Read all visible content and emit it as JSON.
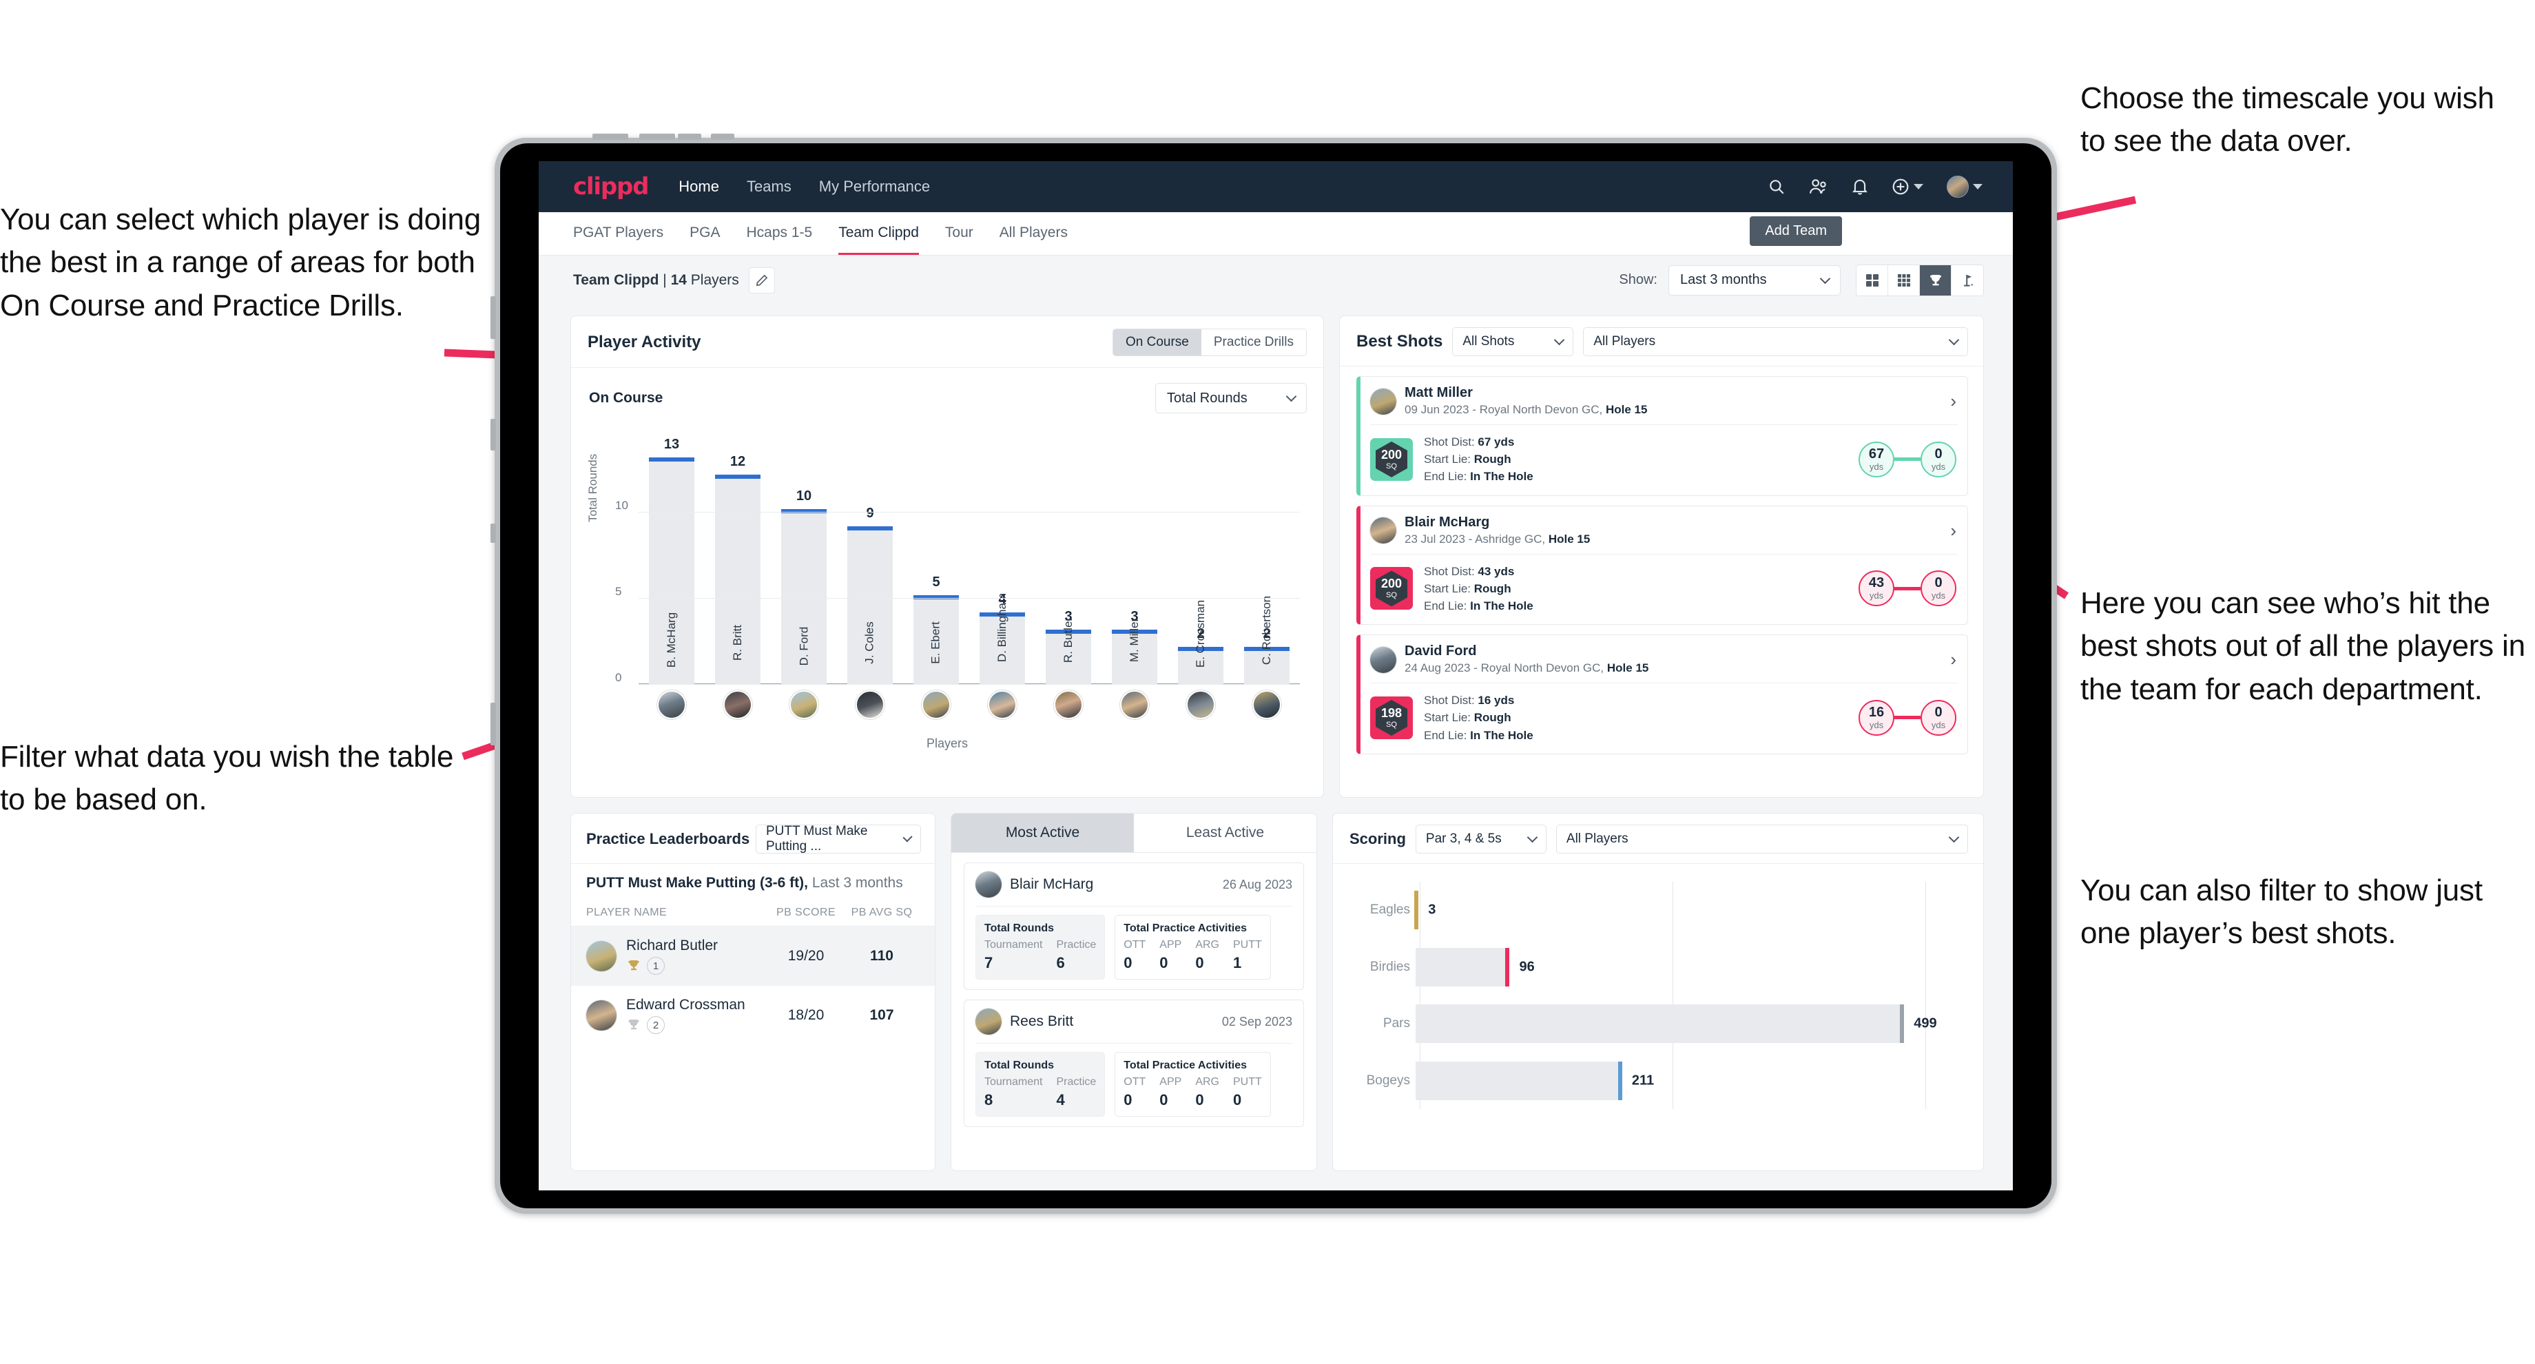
{
  "annotations": {
    "left_top": "You can select which player is doing the best in a range of areas for both On Course and Practice Drills.",
    "left_bottom": "Filter what data you wish the table to be based on.",
    "right_top": "Choose the timescale you wish to see the data over.",
    "right_middle": "Here you can see who’s hit the best shots out of all the players in the team for each department.",
    "right_bottom": "You can also filter to show just one player’s best shots."
  },
  "app": {
    "brand": "clippd",
    "nav": [
      {
        "label": "Home",
        "active": true
      },
      {
        "label": "Teams",
        "active": false
      },
      {
        "label": "My Performance",
        "active": false
      }
    ],
    "nav_icons": [
      "search-icon",
      "people-icon",
      "bell-icon",
      "plus-circle-icon",
      "avatar-icon"
    ],
    "tabs": [
      {
        "label": "PGAT Players",
        "active": false
      },
      {
        "label": "PGA",
        "active": false
      },
      {
        "label": "Hcaps 1-5",
        "active": false
      },
      {
        "label": "Team Clippd",
        "active": true
      },
      {
        "label": "Tour",
        "active": false
      },
      {
        "label": "All Players",
        "active": false
      }
    ],
    "add_team_tooltip": "Add Team",
    "subheader": {
      "team_name": "Team Clippd",
      "separator": " | ",
      "player_count": "14",
      "players_word": " Players",
      "show_label": "Show:",
      "timescale_value": "Last 3 months",
      "view_buttons": [
        "grid-2x2-icon",
        "grid-3x3-icon",
        "trophy-icon",
        "flag-icon"
      ],
      "active_view": "trophy-icon"
    }
  },
  "player_activity": {
    "title": "Player Activity",
    "segments": [
      {
        "label": "On Course",
        "active": true
      },
      {
        "label": "Practice Drills",
        "active": false
      }
    ],
    "sub_title": "On Course",
    "metric_select": "Total Rounds"
  },
  "chart_data": [
    {
      "type": "bar",
      "title": "Player Activity — On Course",
      "xlabel": "Players",
      "ylabel": "Total Rounds",
      "ylim": [
        0,
        14
      ],
      "yticks": [
        0,
        5,
        10
      ],
      "grid": true,
      "categories": [
        "B. McHarg",
        "R. Britt",
        "D. Ford",
        "J. Coles",
        "E. Ebert",
        "D. Billingham",
        "R. Butler",
        "M. Miller",
        "E. Crossman",
        "C. Robertson"
      ],
      "values": [
        13,
        12,
        10,
        9,
        5,
        4,
        3,
        3,
        2,
        2
      ],
      "bar_color": "#e8eaed",
      "cap_color": "#2f6fd0"
    },
    {
      "type": "bar",
      "orientation": "horizontal",
      "title": "Scoring",
      "categories": [
        "Eagles",
        "Birdies",
        "Pars",
        "Bogeys"
      ],
      "values": [
        3,
        96,
        499,
        211
      ],
      "xlim": [
        0,
        560
      ],
      "grid": true,
      "cap_colors": [
        "#c8a552",
        "#ec2c5d",
        "#9aa3ab",
        "#5b9bd5"
      ],
      "bar_color": "#e8eaed"
    }
  ],
  "best_shots": {
    "title": "Best Shots",
    "filter_shots": "All Shots",
    "filter_players": "All Players",
    "shots": [
      {
        "player": "Matt Miller",
        "meta_prefix": "09 Jun 2023 - Royal North Devon GC, ",
        "hole": "Hole 15",
        "sq": "200",
        "sq_unit": "SQ",
        "accent": "#63d3b0",
        "shot_dist_label": "Shot Dist: ",
        "shot_dist": "67 yds",
        "start_lie_label": "Start Lie: ",
        "start_lie": "Rough",
        "end_lie_label": "End Lie: ",
        "end_lie": "In The Hole",
        "from_value": "67",
        "from_unit": "yds",
        "to_value": "0",
        "to_unit": "yds"
      },
      {
        "player": "Blair McHarg",
        "meta_prefix": "23 Jul 2023 - Ashridge GC, ",
        "hole": "Hole 15",
        "sq": "200",
        "sq_unit": "SQ",
        "accent": "#ec2c5d",
        "shot_dist_label": "Shot Dist: ",
        "shot_dist": "43 yds",
        "start_lie_label": "Start Lie: ",
        "start_lie": "Rough",
        "end_lie_label": "End Lie: ",
        "end_lie": "In The Hole",
        "from_value": "43",
        "from_unit": "yds",
        "to_value": "0",
        "to_unit": "yds"
      },
      {
        "player": "David Ford",
        "meta_prefix": "24 Aug 2023 - Royal North Devon GC, ",
        "hole": "Hole 15",
        "sq": "198",
        "sq_unit": "SQ",
        "accent": "#ec2c5d",
        "shot_dist_label": "Shot Dist: ",
        "shot_dist": "16 yds",
        "start_lie_label": "Start Lie: ",
        "start_lie": "Rough",
        "end_lie_label": "End Lie: ",
        "end_lie": "In The Hole",
        "from_value": "16",
        "from_unit": "yds",
        "to_value": "0",
        "to_unit": "yds"
      }
    ]
  },
  "practice_leaderboards": {
    "title": "Practice Leaderboards",
    "drill_select": "PUTT Must Make Putting ...",
    "subtitle_bold": "PUTT Must Make Putting (3-6 ft),",
    "subtitle_rest": " Last 3 months",
    "columns": [
      "PLAYER NAME",
      "PB SCORE",
      "PB AVG SQ"
    ],
    "rows": [
      {
        "name": "Richard Butler",
        "rank": "1",
        "trophy": "gold",
        "pb_score": "19/20",
        "pb_avg_sq": "110"
      },
      {
        "name": "Edward Crossman",
        "rank": "2",
        "trophy": "silver",
        "pb_score": "18/20",
        "pb_avg_sq": "107"
      }
    ]
  },
  "activity_panel": {
    "tabs": [
      {
        "label": "Most Active",
        "active": true
      },
      {
        "label": "Least Active",
        "active": false
      }
    ],
    "cards": [
      {
        "name": "Blair McHarg",
        "date": "26 Aug 2023",
        "rounds_title": "Total Rounds",
        "rounds_keys": [
          "Tournament",
          "Practice"
        ],
        "rounds_values": [
          "7",
          "6"
        ],
        "practice_title": "Total Practice Activities",
        "practice_keys": [
          "OTT",
          "APP",
          "ARG",
          "PUTT"
        ],
        "practice_values": [
          "0",
          "0",
          "0",
          "1"
        ]
      },
      {
        "name": "Rees Britt",
        "date": "02 Sep 2023",
        "rounds_title": "Total Rounds",
        "rounds_keys": [
          "Tournament",
          "Practice"
        ],
        "rounds_values": [
          "8",
          "4"
        ],
        "practice_title": "Total Practice Activities",
        "practice_keys": [
          "OTT",
          "APP",
          "ARG",
          "PUTT"
        ],
        "practice_values": [
          "0",
          "0",
          "0",
          "0"
        ]
      }
    ]
  },
  "scoring": {
    "title": "Scoring",
    "filter_par": "Par 3, 4 & 5s",
    "filter_players": "All Players"
  },
  "colors": {
    "brand_pink": "#ec2c5d",
    "nav_dark": "#1b2a3a",
    "bar_blue": "#2f6fd0",
    "teal": "#63d3b0",
    "page_bg": "#f4f5f7"
  }
}
